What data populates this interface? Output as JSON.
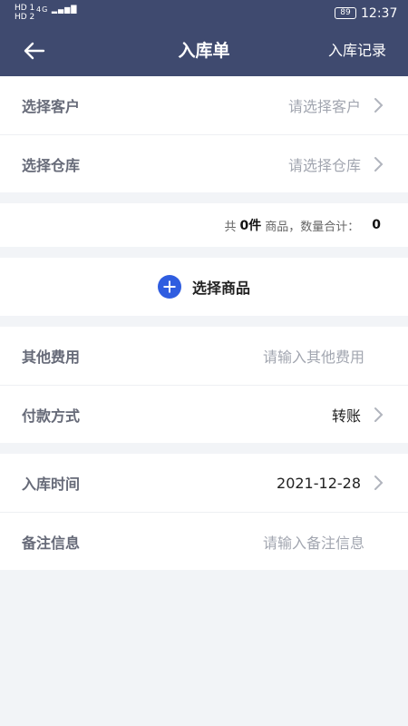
{
  "status": {
    "sim1": "HD 1",
    "sim2": "HD 2",
    "network": "4G",
    "battery": "89",
    "time": "12:37"
  },
  "header": {
    "title": "入库单",
    "right_action": "入库记录"
  },
  "customer": {
    "label": "选择客户",
    "placeholder": "请选择客户"
  },
  "warehouse": {
    "label": "选择仓库",
    "placeholder": "请选择仓库"
  },
  "summary": {
    "prefix": "共",
    "count": "0件",
    "middle": "商品，数量合计：",
    "total": "0"
  },
  "select_goods": {
    "label": "选择商品"
  },
  "other_fee": {
    "label": "其他费用",
    "placeholder": "请输入其他费用"
  },
  "payment": {
    "label": "付款方式",
    "value": "转账"
  },
  "in_time": {
    "label": "入库时间",
    "value": "2021-12-28"
  },
  "remark": {
    "label": "备注信息",
    "placeholder": "请输入备注信息"
  },
  "colors": {
    "header_bg": "#3f4a6f",
    "accent": "#2f5de0",
    "page_bg": "#f2f4f7"
  }
}
